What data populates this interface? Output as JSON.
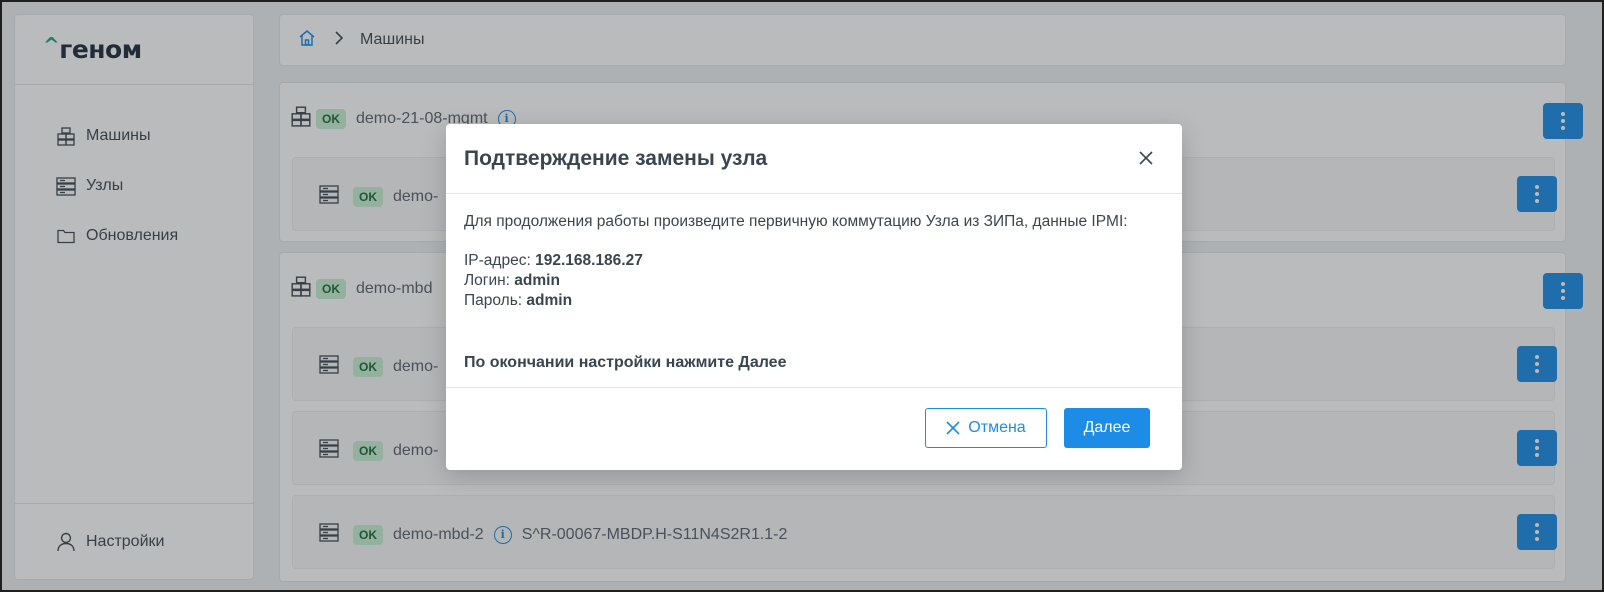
{
  "logo": {
    "caret": "^",
    "text": "геном"
  },
  "sidebar": {
    "items": [
      {
        "label": "Машины",
        "icon": "machines-icon"
      },
      {
        "label": "Узлы",
        "icon": "nodes-icon"
      },
      {
        "label": "Обновления",
        "icon": "folder-icon"
      }
    ],
    "settings_label": "Настройки"
  },
  "breadcrumb": {
    "current": "Машины"
  },
  "machines": [
    {
      "name": "demo-21-08-mgmt",
      "status": "OK",
      "nodes": [
        {
          "name": "demo-",
          "status": "OK"
        }
      ]
    },
    {
      "name": "demo-mbd",
      "status": "OK",
      "nodes": [
        {
          "name": "demo-",
          "status": "OK"
        },
        {
          "name": "demo-",
          "status": "OK"
        },
        {
          "name": "demo-mbd-2",
          "status": "OK",
          "serial": "S^R-00067-MBDP.H-S11N4S2R1.1-2"
        }
      ]
    }
  ],
  "modal": {
    "title": "Подтверждение замены узла",
    "intro": "Для продолжения работы произведите первичную коммутацию Узла из ЗИПа, данные IPMI:",
    "ip_label": "IP-адрес:",
    "ip_value": "192.168.186.27",
    "login_label": "Логин:",
    "login_value": "admin",
    "password_label": "Пароль:",
    "password_value": "admin",
    "final_note": "По окончании настройки нажмите Далее",
    "cancel_label": "Отмена",
    "next_label": "Далее"
  },
  "colors": {
    "accent": "#1d8ce6",
    "ok_badge_bg": "#c8f0d4",
    "ok_badge_text": "#1c6b3a",
    "logo_caret": "#1aa39a"
  }
}
